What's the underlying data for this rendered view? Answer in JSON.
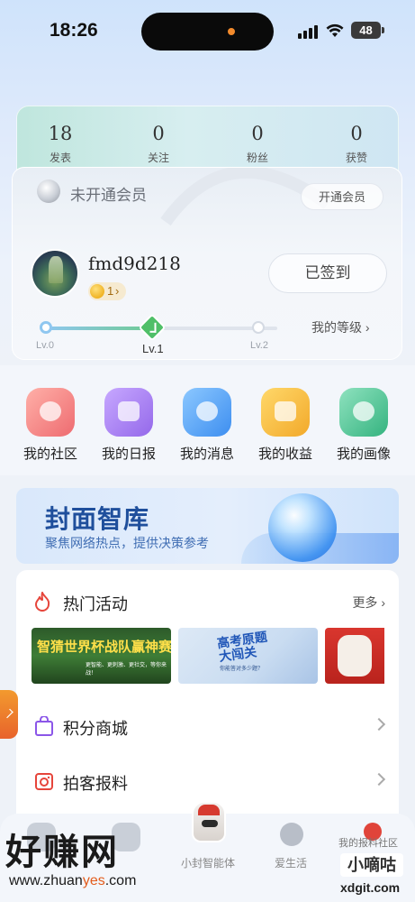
{
  "status_bar": {
    "time": "18:26",
    "battery": "48"
  },
  "stats": [
    {
      "value": "18",
      "label": "发表"
    },
    {
      "value": "0",
      "label": "关注"
    },
    {
      "value": "0",
      "label": "粉丝"
    },
    {
      "value": "0",
      "label": "获赞"
    }
  ],
  "member": {
    "status": "未开通会员",
    "open_button": "开通会员"
  },
  "profile": {
    "username": "fmd9d218",
    "coins": "1",
    "sign_button": "已签到"
  },
  "level": {
    "levels": [
      "Lv.0",
      "Lv.1",
      "Lv.2"
    ],
    "current": "Lv.1",
    "progress": 0.5,
    "my_level_link": "我的等级 ›"
  },
  "quick_actions": [
    {
      "label": "我的社区",
      "icon": "planet-icon",
      "color": "#f0777a"
    },
    {
      "label": "我的日报",
      "icon": "newspaper-icon",
      "color": "#a47ff0"
    },
    {
      "label": "我的消息",
      "icon": "message-bubble-icon",
      "color": "#4a9ff0"
    },
    {
      "label": "我的收益",
      "icon": "wallet-icon",
      "color": "#f2b733"
    },
    {
      "label": "我的画像",
      "icon": "pie-chart-icon",
      "color": "#45c091"
    }
  ],
  "banner": {
    "title": "封面智库",
    "subtitle": "聚焦网络热点，提供决策参考"
  },
  "activities": {
    "title": "热门活动",
    "more": "更多 ›",
    "thumbs": [
      {
        "title": "智猜世界杯战队赢神赛",
        "subtitle": "更智能、更刺激、更社交，等你来战！"
      },
      {
        "title": "高考原题大闯关",
        "subtitle": "你能答对多少题？"
      }
    ]
  },
  "list": [
    {
      "label": "积分商城",
      "icon": "shopping-bag-icon"
    },
    {
      "label": "拍客报料",
      "icon": "camera-icon"
    }
  ],
  "bottom_nav": [
    {
      "label": "小封智能体",
      "icon": "mascot-icon"
    },
    {
      "label": "爱生活",
      "icon": "lightbulb-icon"
    }
  ],
  "watermark": {
    "left_big": "好赚网",
    "left_url_a": "www.zhuan",
    "left_url_b": "yes",
    "left_url_c": ".com",
    "right_top": "我的报料社区",
    "right_mid": "小嘀咕",
    "right_url": "xdgit.com"
  },
  "colors": {
    "accent_green": "#4fbf68",
    "banner_blue": "#1f4f9c",
    "fire_red": "#e6453b"
  }
}
